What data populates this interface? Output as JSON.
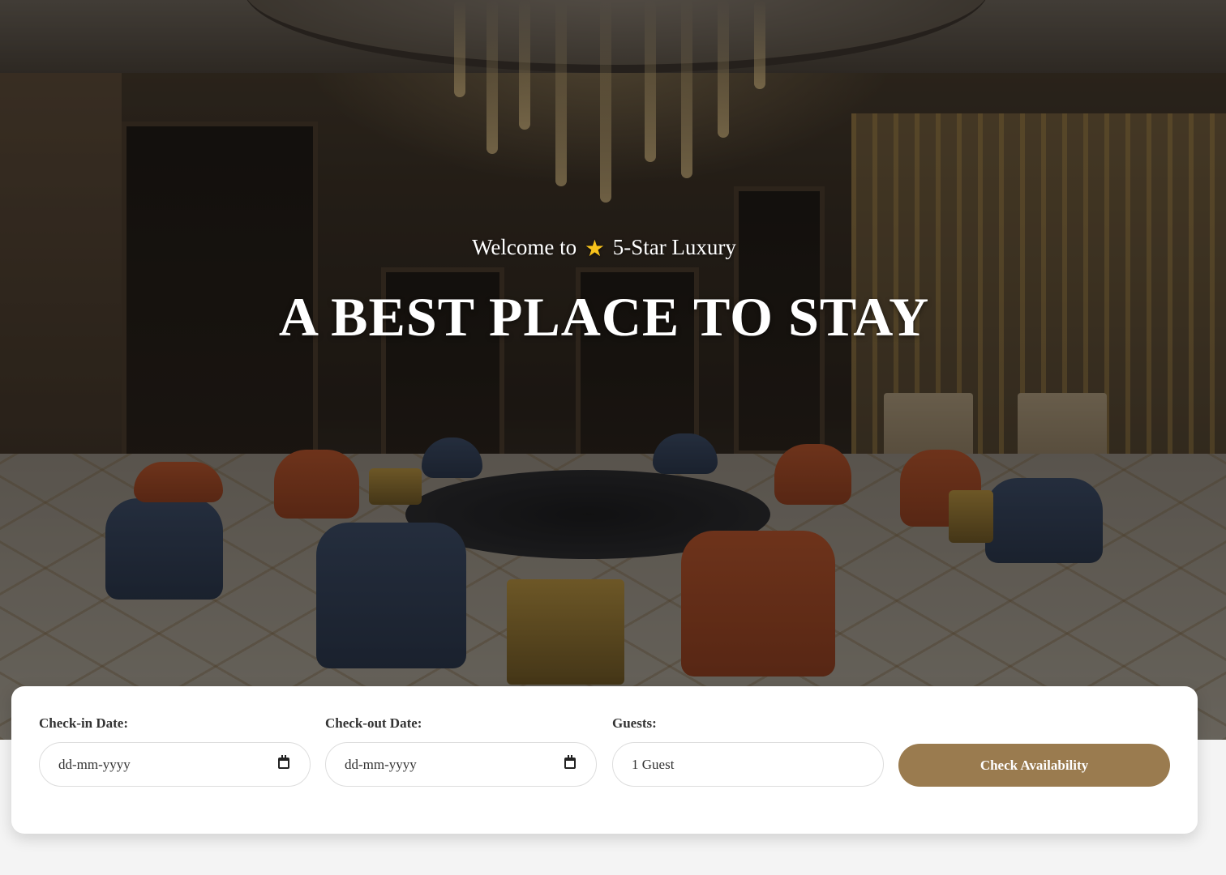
{
  "hero": {
    "welcome_prefix": "Welcome to",
    "star_glyph": "★",
    "welcome_suffix": "5-Star Luxury",
    "headline": "A BEST PLACE TO STAY"
  },
  "booking": {
    "checkin": {
      "label": "Check-in Date:",
      "value": "dd-mm-yyyy",
      "icon": "calendar-icon"
    },
    "checkout": {
      "label": "Check-out Date:",
      "value": "dd-mm-yyyy",
      "icon": "calendar-icon"
    },
    "guests": {
      "label": "Guests:",
      "value": "1 Guest"
    },
    "submit_label": "Check Availability"
  },
  "colors": {
    "accent": "#9a7b4f",
    "star": "#f7c21b",
    "page_background": "#f4f4f4"
  }
}
